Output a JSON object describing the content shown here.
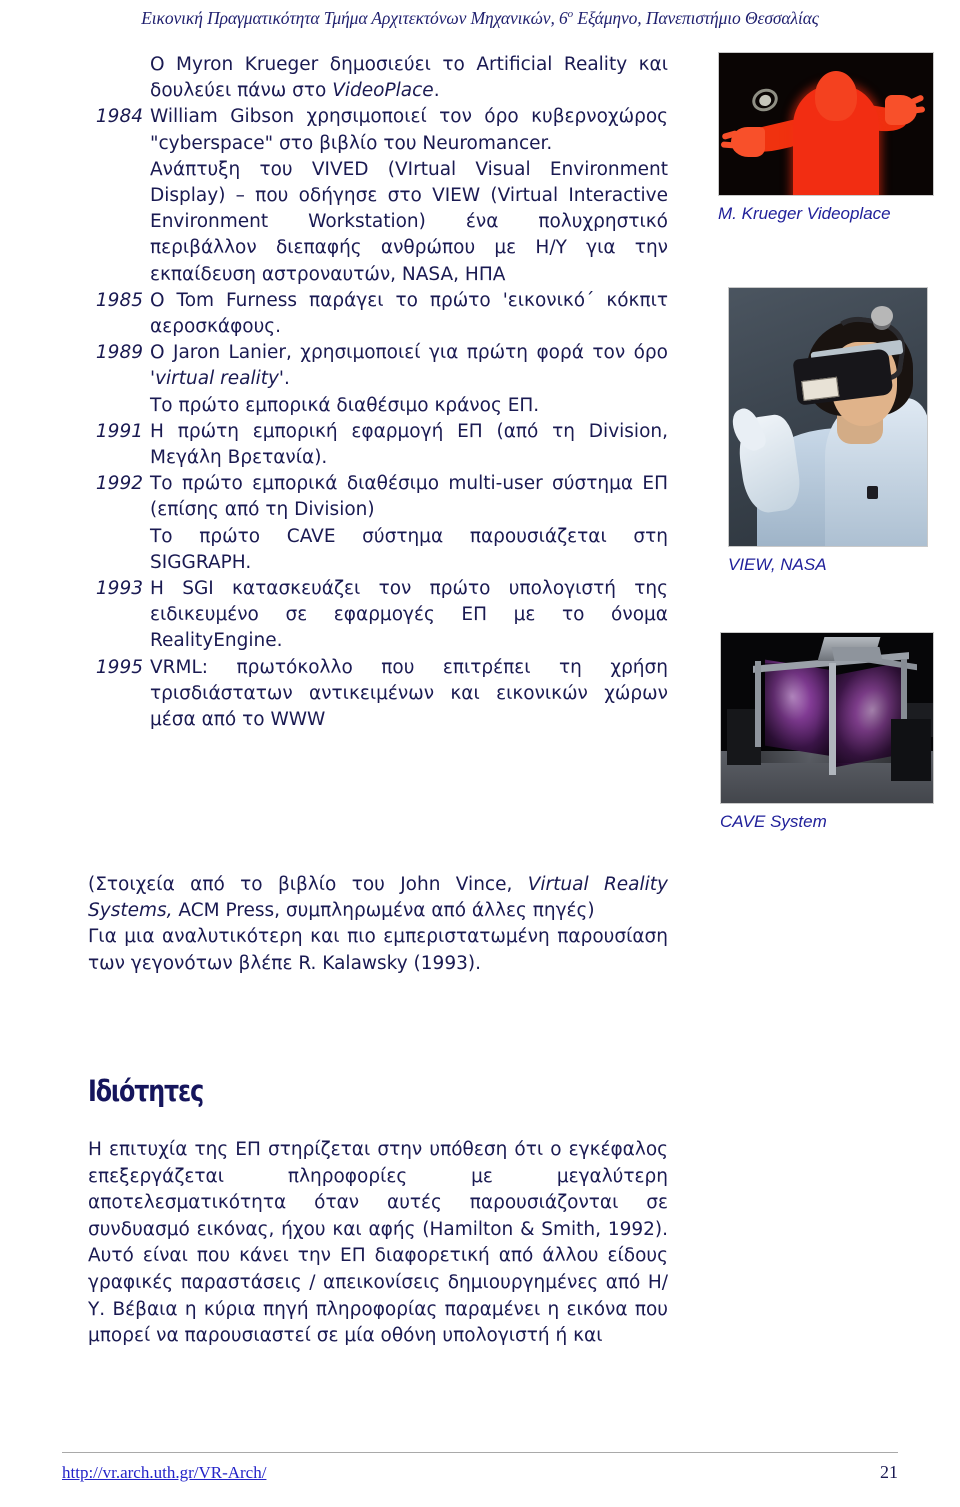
{
  "header": {
    "title_before": "Εικονική Πραγματικότητα Τμήμα Αρχιτεκτόνων Μηχανικών, 6",
    "title_sup": "ο",
    "title_after": " Εξάμηνο, Πανεπιστήμιο Θεσσαλίας"
  },
  "timeline": {
    "rows": [
      {
        "year": "",
        "text": "Ο Myron Krueger δημοσιεύει το Artificial Reality και δουλεύει πάνω στο VideoPlace."
      },
      {
        "year": "1984",
        "text": "William Gibson χρησιμοποιεί τον όρο κυβερνοχώρος \"cyberspace\" στο βιβλίο του Neuromancer."
      },
      {
        "year": "",
        "text": "Ανάπτυξη του VIVED (VIrtual Visual Environment Display) – που οδήγησε στο VIEW (Virtual Interactive Environment Workstation) ένα πολυχρηστικό περιβάλλον διεπαφής ανθρώπου με Η/Υ για την εκπαίδευση αστροναυτών, NASA, ΗΠΑ"
      },
      {
        "year": "1985",
        "text": "Ο Tom Furness παράγει το πρώτο 'εικονικό΄ κόκπιτ αεροσκάφους."
      },
      {
        "year": "1989",
        "text": "Ο Jaron Lanier, χρησιμοποιεί για πρώτη φορά τον όρο 'virtual reality'."
      },
      {
        "year": "",
        "text": "Το πρώτο εμπορικά διαθέσιμο κράνος ΕΠ."
      },
      {
        "year": "1991",
        "text": "Η πρώτη εμπορική εφαρμογή ΕΠ (από τη Division, Μεγάλη Βρετανία)."
      },
      {
        "year": "1992",
        "text": "Το πρώτο εμπορικά διαθέσιμο multi-user σύστημα ΕΠ (επίσης από τη Division)"
      },
      {
        "year": "",
        "text": "Το πρώτο CAVE σύστημα παρουσιάζεται στη SIGGRAPH."
      },
      {
        "year": "1993",
        "text": "Η SGI κατασκευάζει τον πρώτο υπολογιστή της ειδικευμένο σε εφαρμογές ΕΠ με το όνομα RealityEngine."
      },
      {
        "year": "1995",
        "text": "VRML: πρωτόκολλο που επιτρέπει τη χρήση τρισδιάστατων αντικειμένων και εικονικών χώρων μέσα από το WWW"
      }
    ]
  },
  "notes": {
    "source_line_1": "(Στοιχεία από το βιβλίο του John Vince, ",
    "source_italic_1": "Virtual Reality Systems,",
    "source_line_2": " ACM Press, συμπληρωμένα από άλλες πηγές)",
    "source_line_3": "Για μια αναλυτικότερη και πιο εμπεριστατωμένη παρουσίαση των γεγονότων βλέπε R. Kalawsky (1993)."
  },
  "section": {
    "heading": "Ιδιότητες",
    "paragraph": "Η επιτυχία της ΕΠ στηρίζεται στην υπόθεση ότι ο εγκέφαλος επεξεργάζεται πληροφορίες με μεγαλύτερη αποτελεσματικότητα όταν αυτές παρουσιάζονται σε συνδυασμό εικόνας, ήχου και αφής (Hamilton & Smith, 1992). Αυτό είναι που κάνει την ΕΠ διαφορετική από άλλου είδους γραφικές παραστάσεις / απεικονίσεις δημιουργημένες από Η/Υ. Βέβαια η κύρια πηγή πληροφορίας παραμένει η εικόνα που μπορεί να παρουσιαστεί σε μία οθόνη υπολογιστή ή και"
  },
  "figures": [
    {
      "caption": "M. Krueger Videoplace",
      "alt": "red-silhouette-videoplace"
    },
    {
      "caption": "VIEW, NASA",
      "alt": "person-wearing-hmd-and-dataglove"
    },
    {
      "caption": "CAVE System",
      "alt": "cave-projection-room"
    }
  ],
  "footer": {
    "link": "http://vr.arch.uth.gr/VR-Arch/",
    "page": "21"
  },
  "colors": {
    "text": "#1a1a52",
    "header": "#1f1f6e",
    "link": "#2323c8",
    "caption": "#20209a"
  }
}
